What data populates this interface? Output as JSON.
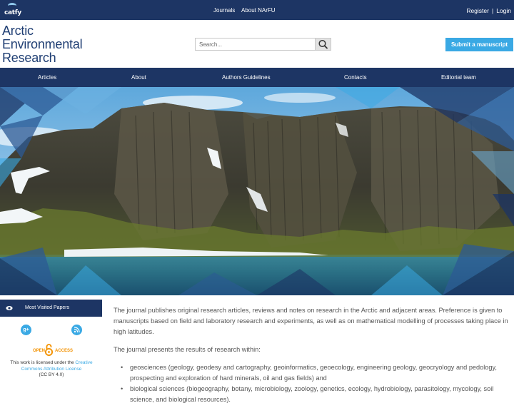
{
  "topbar": {
    "logo_text": "catfy",
    "nav": [
      "Journals",
      "About NArFU"
    ],
    "register_label": "Register",
    "separator": "|",
    "login_label": "Login"
  },
  "header": {
    "title_lines": [
      "Arctic",
      "Environmental",
      "Research"
    ],
    "search_placeholder": "Search...",
    "submit_label": "Submit a manuscript"
  },
  "main_nav": [
    "Articles",
    "About",
    "Authors Guidelines",
    "Contacts",
    "Editorial team"
  ],
  "sidebar": {
    "most_visited_label": "Most Visited Papers",
    "google_plus_glyph": "g+",
    "open_access": {
      "open": "OPEN",
      "access": "ACCESS"
    },
    "license_text_1": "This work is licensed under the ",
    "license_link": "Creative Commons Attribution License",
    "license_short": "(CC BY 4.0)"
  },
  "content": {
    "paragraph_1": "The journal publishes original research articles, reviews and notes on research in the Arctic and adjacent areas. Preference is given to manuscripts based on field and laboratory research and experiments, as well as on mathematical modelling of processes taking place in high latitudes.",
    "paragraph_2": "The journal presents the results of research within:",
    "list_items": [
      "geosciences (geology, geodesy and cartography, geoinformatics, geoecology, engineering geology, geocryology and pedology, prospecting and exploration of hard minerals, oil and gas fields) and",
      "biological sciences (biogeography, botany, microbiology, zoology, genetics, ecology, hydrobiology, parasitology, mycology, soil science, and biological resources)."
    ]
  },
  "colors": {
    "navy": "#1d3564",
    "title_blue": "#1f3e73",
    "accent_blue": "#3aa9e4",
    "open_access_orange": "#f39200"
  },
  "icons": {
    "search": "search-icon",
    "eye": "eye-icon",
    "google_plus": "google-plus-icon",
    "rss": "rss-icon",
    "open_access": "open-access-lock-icon"
  }
}
